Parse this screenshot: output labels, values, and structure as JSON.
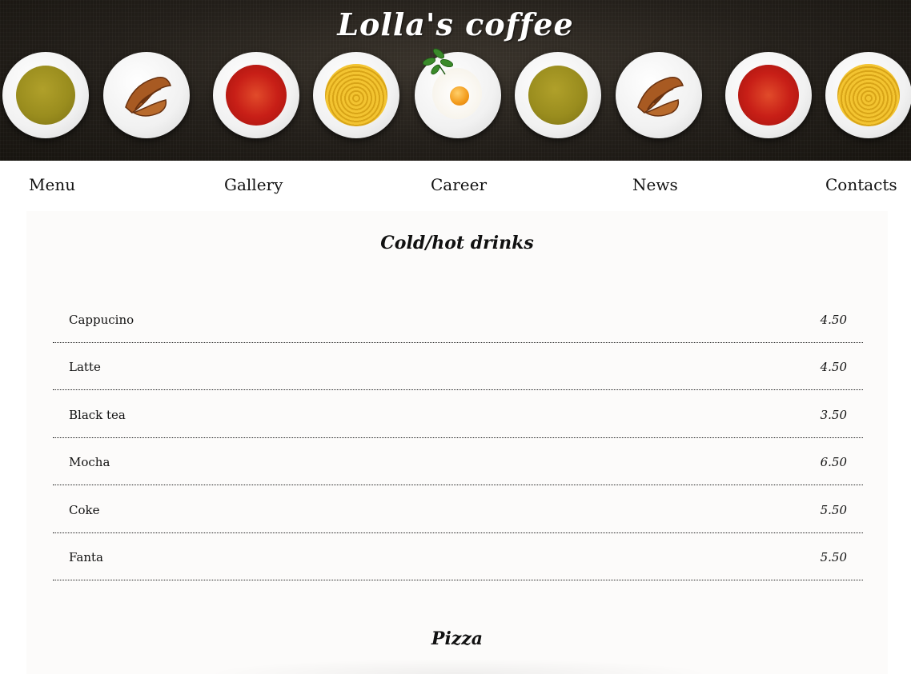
{
  "header": {
    "title": "Lolla's coffee",
    "background_color": "#231f1a",
    "plates": [
      {
        "dish": "soup"
      },
      {
        "dish": "croissant"
      },
      {
        "dish": "tomato-pasta"
      },
      {
        "dish": "spaghetti"
      },
      {
        "dish": "fried-egg"
      },
      {
        "dish": "soup"
      },
      {
        "dish": "croissant"
      },
      {
        "dish": "tomato-pasta"
      },
      {
        "dish": "spaghetti"
      }
    ]
  },
  "nav": {
    "items": [
      {
        "label": "Menu"
      },
      {
        "label": "Gallery"
      },
      {
        "label": "Career"
      },
      {
        "label": "News"
      },
      {
        "label": "Contacts"
      }
    ]
  },
  "menu": {
    "sections": [
      {
        "title": "Cold/hot drinks",
        "items": [
          {
            "name": "Cappucino",
            "price": "4.50"
          },
          {
            "name": "Latte",
            "price": "4.50"
          },
          {
            "name": "Black tea",
            "price": "3.50"
          },
          {
            "name": "Mocha",
            "price": "6.50"
          },
          {
            "name": "Coke",
            "price": "5.50"
          },
          {
            "name": "Fanta",
            "price": "5.50"
          }
        ]
      },
      {
        "title": "Pizza",
        "items": []
      }
    ]
  },
  "colors": {
    "content_background": "#fcfbfa",
    "text": "#111111",
    "divider": "#222222"
  }
}
